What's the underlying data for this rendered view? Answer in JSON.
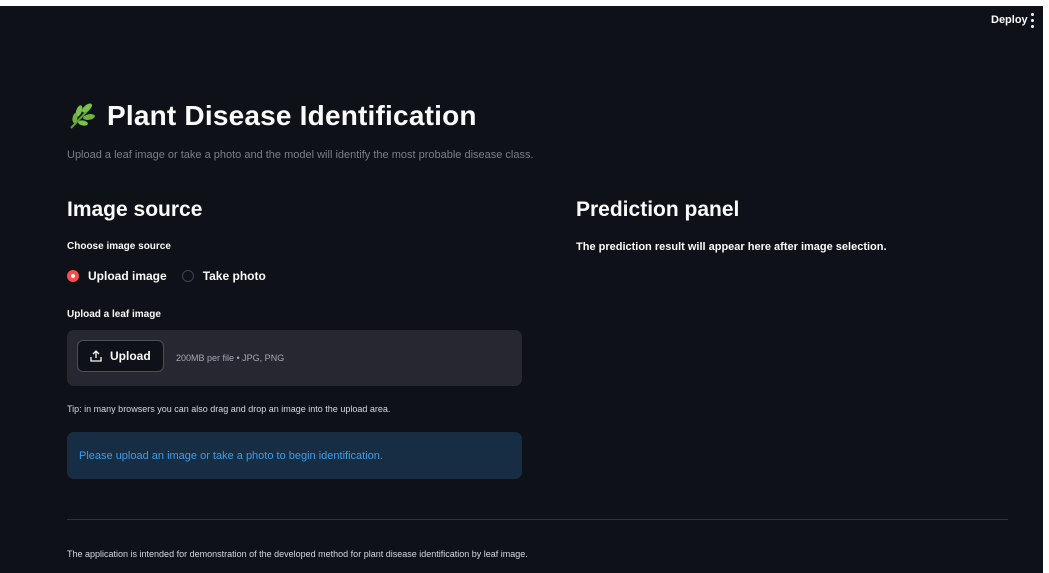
{
  "toolbar": {
    "deploy_label": "Deploy"
  },
  "header": {
    "title": "Plant Disease Identification",
    "subtitle": "Upload a leaf image or take a photo and the model will identify the most probable disease class."
  },
  "left": {
    "heading": "Image source",
    "source_label": "Choose image source",
    "radio_options": [
      {
        "label": "Upload image",
        "selected": true
      },
      {
        "label": "Take photo",
        "selected": false
      }
    ],
    "upload_label": "Upload a leaf image",
    "upload_button": "Upload",
    "upload_limits": "200MB per file • JPG, PNG",
    "tip": "Tip: in many browsers you can also drag and drop an image into the upload area.",
    "info_message": "Please upload an image or take a photo to begin identification."
  },
  "right": {
    "heading": "Prediction panel",
    "placeholder": "The prediction result will appear here after image selection."
  },
  "footer": {
    "text": "The application is intended for demonstration of the developed method for plant disease identification by leaf image."
  },
  "colors": {
    "background": "#0e1117",
    "accent": "#ff4b4b",
    "info_bg": "#172d43",
    "info_text": "#3b9ee8",
    "leaf_icon": "#7cc14a"
  },
  "icons": {
    "title_icon": "herb-leaf-icon",
    "upload_icon": "upload-icon",
    "menu_icon": "vertical-dots-icon"
  }
}
